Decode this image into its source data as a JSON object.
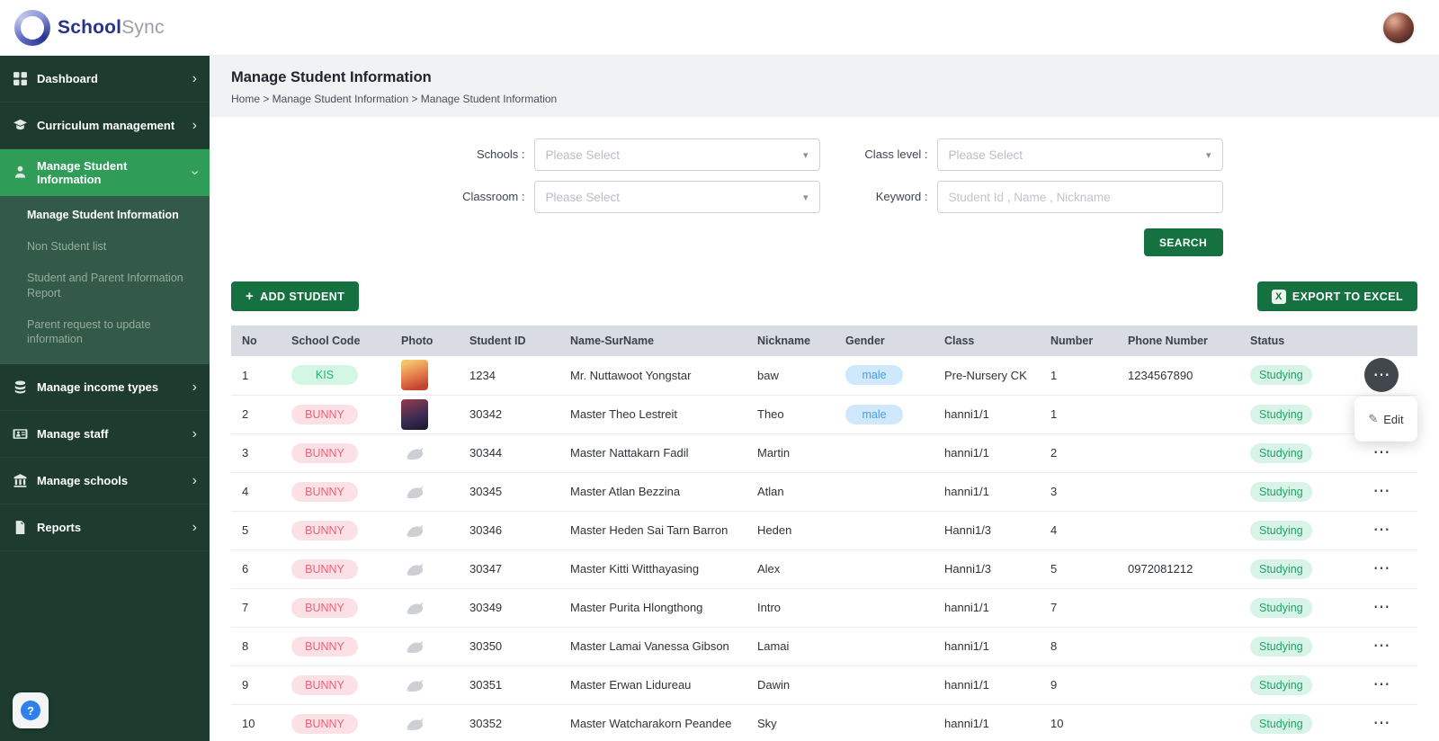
{
  "brand": {
    "bold": "School",
    "light": "Sync"
  },
  "icons": {
    "plus": "+",
    "dots": "⋯",
    "question": "?",
    "chevron": "›",
    "caret": "▾",
    "edit": "✎",
    "excel": "X"
  },
  "colors": {
    "sidebar_bg": "#1d3b2f",
    "sidebar_active": "#2f9d58",
    "submenu_bg": "#335948",
    "button_green": "#15713f",
    "badge_green": "#27b375",
    "badge_pink": "#ef5f76",
    "badge_blue": "#44a1ee",
    "status_green": "#1ea564",
    "header_gray": "#d9dce2"
  },
  "sidebar": {
    "items": [
      {
        "label": "Dashboard"
      },
      {
        "label": "Curriculum management"
      },
      {
        "label": "Manage Student Information"
      },
      {
        "label": "Manage income types"
      },
      {
        "label": "Manage staff"
      },
      {
        "label": "Manage schools"
      },
      {
        "label": "Reports"
      }
    ],
    "submenu": [
      {
        "label": "Manage Student Information"
      },
      {
        "label": "Non Student list"
      },
      {
        "label": "Student and Parent Information Report"
      },
      {
        "label": "Parent request to update information"
      }
    ]
  },
  "page": {
    "title": "Manage Student Information",
    "breadcrumb": "Home > Manage Student Information > Manage Student Information"
  },
  "filters": {
    "schools_label": "Schools :",
    "classroom_label": "Classroom :",
    "class_level_label": "Class level :",
    "keyword_label": "Keyword :",
    "select_placeholder": "Please Select",
    "keyword_placeholder": "Student Id , Name , Nickname",
    "search_button": "SEARCH"
  },
  "toolbar": {
    "add_student": "ADD STUDENT",
    "export_excel": "EXPORT TO EXCEL"
  },
  "table": {
    "headers": [
      "No",
      "School Code",
      "Photo",
      "Student ID",
      "Name-SurName",
      "Nickname",
      "Gender",
      "Class",
      "Number",
      "Phone Number",
      "Status"
    ],
    "rows": [
      {
        "no": "1",
        "school_code": "KIS",
        "code_color": "green",
        "photo": "avatar1",
        "student_id": "1234",
        "name": "Mr. Nuttawoot Yongstar",
        "nickname": "baw",
        "gender": "male",
        "class": "Pre-Nursery CK",
        "number": "1",
        "phone": "1234567890",
        "status": "Studying",
        "menu_open": true
      },
      {
        "no": "2",
        "school_code": "BUNNY",
        "code_color": "pink",
        "photo": "avatar2",
        "student_id": "30342",
        "name": "Master Theo Lestreit",
        "nickname": "Theo",
        "gender": "male",
        "class": "hanni1/1",
        "number": "1",
        "phone": "",
        "status": "Studying"
      },
      {
        "no": "3",
        "school_code": "BUNNY",
        "code_color": "pink",
        "photo": "placeholder",
        "student_id": "30344",
        "name": "Master Nattakarn Fadil",
        "nickname": "Martin",
        "gender": "",
        "class": "hanni1/1",
        "number": "2",
        "phone": "",
        "status": "Studying"
      },
      {
        "no": "4",
        "school_code": "BUNNY",
        "code_color": "pink",
        "photo": "placeholder",
        "student_id": "30345",
        "name": "Master Atlan Bezzina",
        "nickname": "Atlan",
        "gender": "",
        "class": "hanni1/1",
        "number": "3",
        "phone": "",
        "status": "Studying"
      },
      {
        "no": "5",
        "school_code": "BUNNY",
        "code_color": "pink",
        "photo": "placeholder",
        "student_id": "30346",
        "name": "Master Heden Sai Tarn Barron",
        "nickname": "Heden",
        "gender": "",
        "class": "Hanni1/3",
        "number": "4",
        "phone": "",
        "status": "Studying"
      },
      {
        "no": "6",
        "school_code": "BUNNY",
        "code_color": "pink",
        "photo": "placeholder",
        "student_id": "30347",
        "name": "Master Kitti Witthayasing",
        "nickname": "Alex",
        "gender": "",
        "class": "Hanni1/3",
        "number": "5",
        "phone": "0972081212",
        "status": "Studying"
      },
      {
        "no": "7",
        "school_code": "BUNNY",
        "code_color": "pink",
        "photo": "placeholder",
        "student_id": "30349",
        "name": "Master Purita Hlongthong",
        "nickname": "Intro",
        "gender": "",
        "class": "hanni1/1",
        "number": "7",
        "phone": "",
        "status": "Studying"
      },
      {
        "no": "8",
        "school_code": "BUNNY",
        "code_color": "pink",
        "photo": "placeholder",
        "student_id": "30350",
        "name": "Master Lamai Vanessa Gibson",
        "nickname": "Lamai",
        "gender": "",
        "class": "hanni1/1",
        "number": "8",
        "phone": "",
        "status": "Studying"
      },
      {
        "no": "9",
        "school_code": "BUNNY",
        "code_color": "pink",
        "photo": "placeholder",
        "student_id": "30351",
        "name": "Master Erwan Lidureau",
        "nickname": "Dawin",
        "gender": "",
        "class": "hanni1/1",
        "number": "9",
        "phone": "",
        "status": "Studying"
      },
      {
        "no": "10",
        "school_code": "BUNNY",
        "code_color": "pink",
        "photo": "placeholder",
        "student_id": "30352",
        "name": "Master Watcharakorn Peandee",
        "nickname": "Sky",
        "gender": "",
        "class": "hanni1/1",
        "number": "10",
        "phone": "",
        "status": "Studying"
      }
    ]
  },
  "action_menu": {
    "edit": "Edit"
  }
}
